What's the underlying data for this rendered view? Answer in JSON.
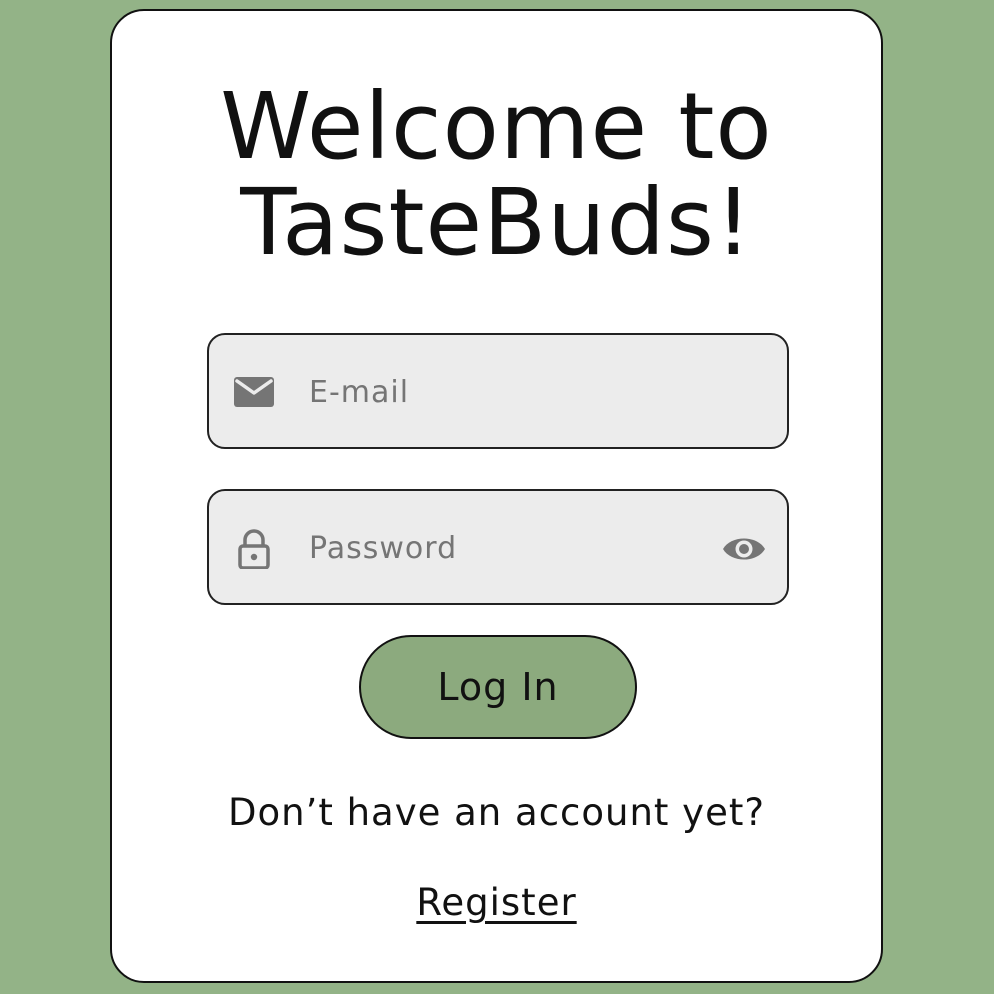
{
  "colors": {
    "background": "#93b387",
    "card": "#ffffff",
    "input_fill": "#ececec",
    "button_fill": "#8caa7e",
    "text": "#111111",
    "icon": "#757575"
  },
  "header": {
    "title_line1": "Welcome to",
    "title_line2": "TasteBuds!"
  },
  "form": {
    "email": {
      "icon": "mail-icon",
      "placeholder": "E-mail",
      "value": ""
    },
    "password": {
      "icon": "lock-icon",
      "placeholder": "Password",
      "value": "",
      "toggle_icon": "eye-icon"
    },
    "login_label": "Log In"
  },
  "footer": {
    "prompt": "Don’t have an account yet?",
    "register_label": "Register"
  }
}
